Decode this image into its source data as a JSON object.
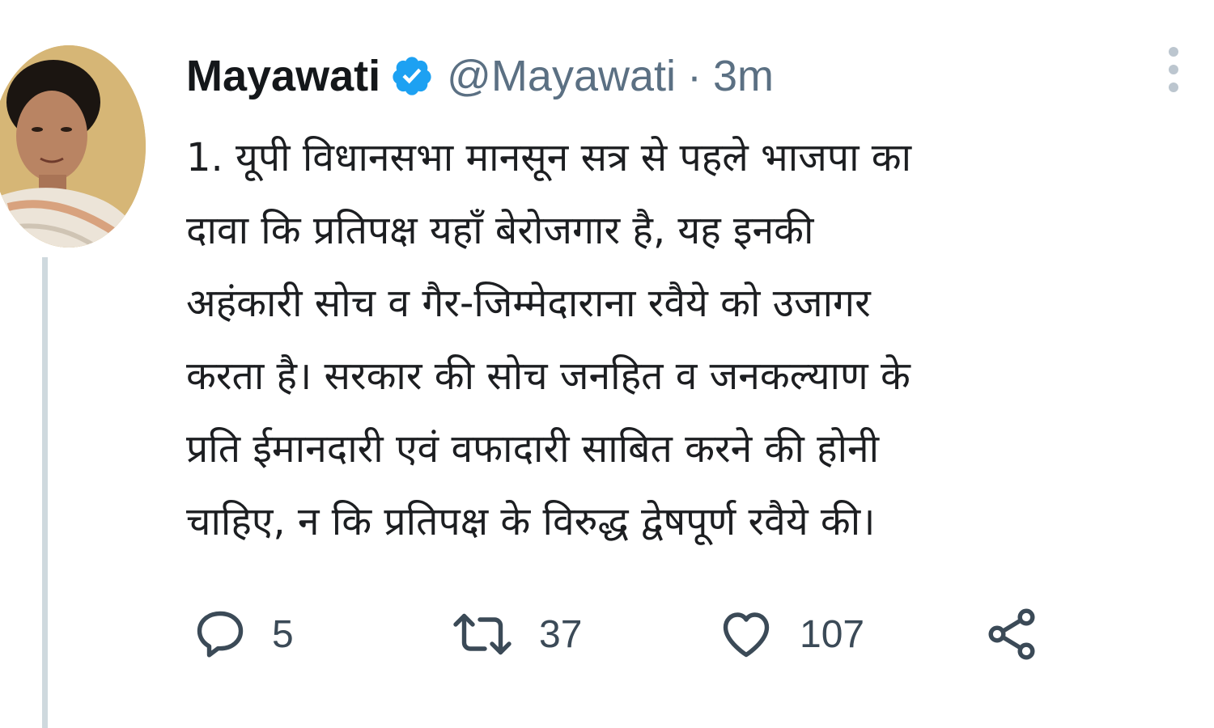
{
  "author": {
    "name": "Mayawati",
    "handle": "@Mayawati",
    "separator": "·",
    "time": "3m",
    "verified": true,
    "avatar": "avatar-photo"
  },
  "tweet": {
    "lines": [
      "1. यूपी विधानसभा मानसून सत्र से पहले भाजपा का",
      "दावा कि प्रतिपक्ष यहाँ बेरोजगार है, यह इनकी",
      "अहंकारी सोच व गैर-जिम्मेदाराना रवैये को उजागर",
      "करता है। सरकार की सोच जनहित व जनकल्याण के",
      "प्रति ईमानदारी एवं वफादारी साबित करने की होनी",
      "चाहिए, न कि प्रतिपक्ष के विरुद्ध द्वेषपूर्ण रवैये की।"
    ]
  },
  "actions": {
    "reply_count": "5",
    "retweet_count": "37",
    "like_count": "107"
  },
  "icons": {
    "verified": "verified-badge-icon",
    "more": "more-options-icon",
    "reply": "reply-icon",
    "retweet": "retweet-icon",
    "like": "heart-icon",
    "share": "share-icon"
  },
  "colors": {
    "verified_blue": "#1da1f2",
    "secondary_text": "#5b7083",
    "icon_gray": "#3b4a57",
    "thread_line": "#cfd9de"
  }
}
